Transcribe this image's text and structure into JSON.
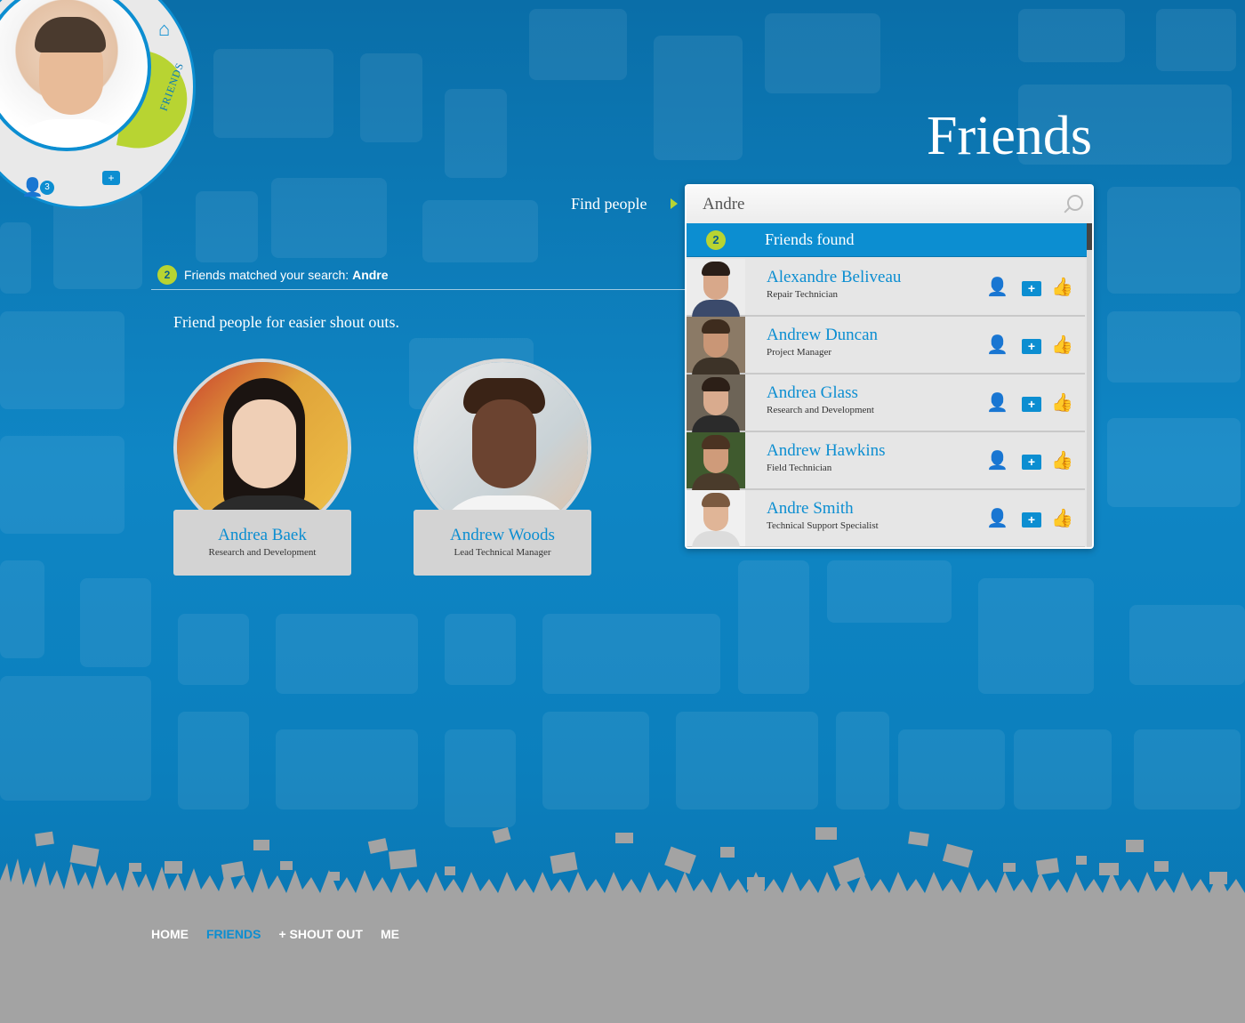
{
  "header": {
    "title": "Friends"
  },
  "profile_widget": {
    "friends_tab_label": "FRIENDS",
    "requests_count": "3",
    "home_icon": "home-icon",
    "people_icon": "people-icon",
    "shout_icon": "shout-plus-icon"
  },
  "search": {
    "label": "Find people",
    "query": "Andre",
    "results_count": "2",
    "results_label": "Friends found",
    "results": [
      {
        "name": "Alexandre Beliveau",
        "role": "Repair Technician"
      },
      {
        "name": "Andrew Duncan",
        "role": "Project Manager"
      },
      {
        "name": "Andrea Glass",
        "role": "Research and Development"
      },
      {
        "name": "Andrew Hawkins",
        "role": "Field Technician"
      },
      {
        "name": "Andre Smith",
        "role": "Technical Support Specialist"
      }
    ],
    "action_icons": [
      "add-friend-icon",
      "shout-out-icon",
      "like-icon"
    ]
  },
  "matched": {
    "count": "2",
    "text": "Friends matched your search:",
    "query": "Andre"
  },
  "tagline": "Friend people for easier shout outs.",
  "friends": [
    {
      "name": "Andrea Baek",
      "role": "Research and Development"
    },
    {
      "name": "Andrew Woods",
      "role": "Lead Technical Manager"
    }
  ],
  "footer": {
    "nav": [
      {
        "label": "HOME",
        "active": false
      },
      {
        "label": "FRIENDS",
        "active": true
      },
      {
        "label": "+ SHOUT OUT",
        "active": false
      },
      {
        "label": "ME",
        "active": false
      }
    ]
  },
  "colors": {
    "accent_blue": "#0c8ed1",
    "accent_green": "#b8d432",
    "background": "#0f86c5",
    "footer_gray": "#a3a3a3"
  }
}
